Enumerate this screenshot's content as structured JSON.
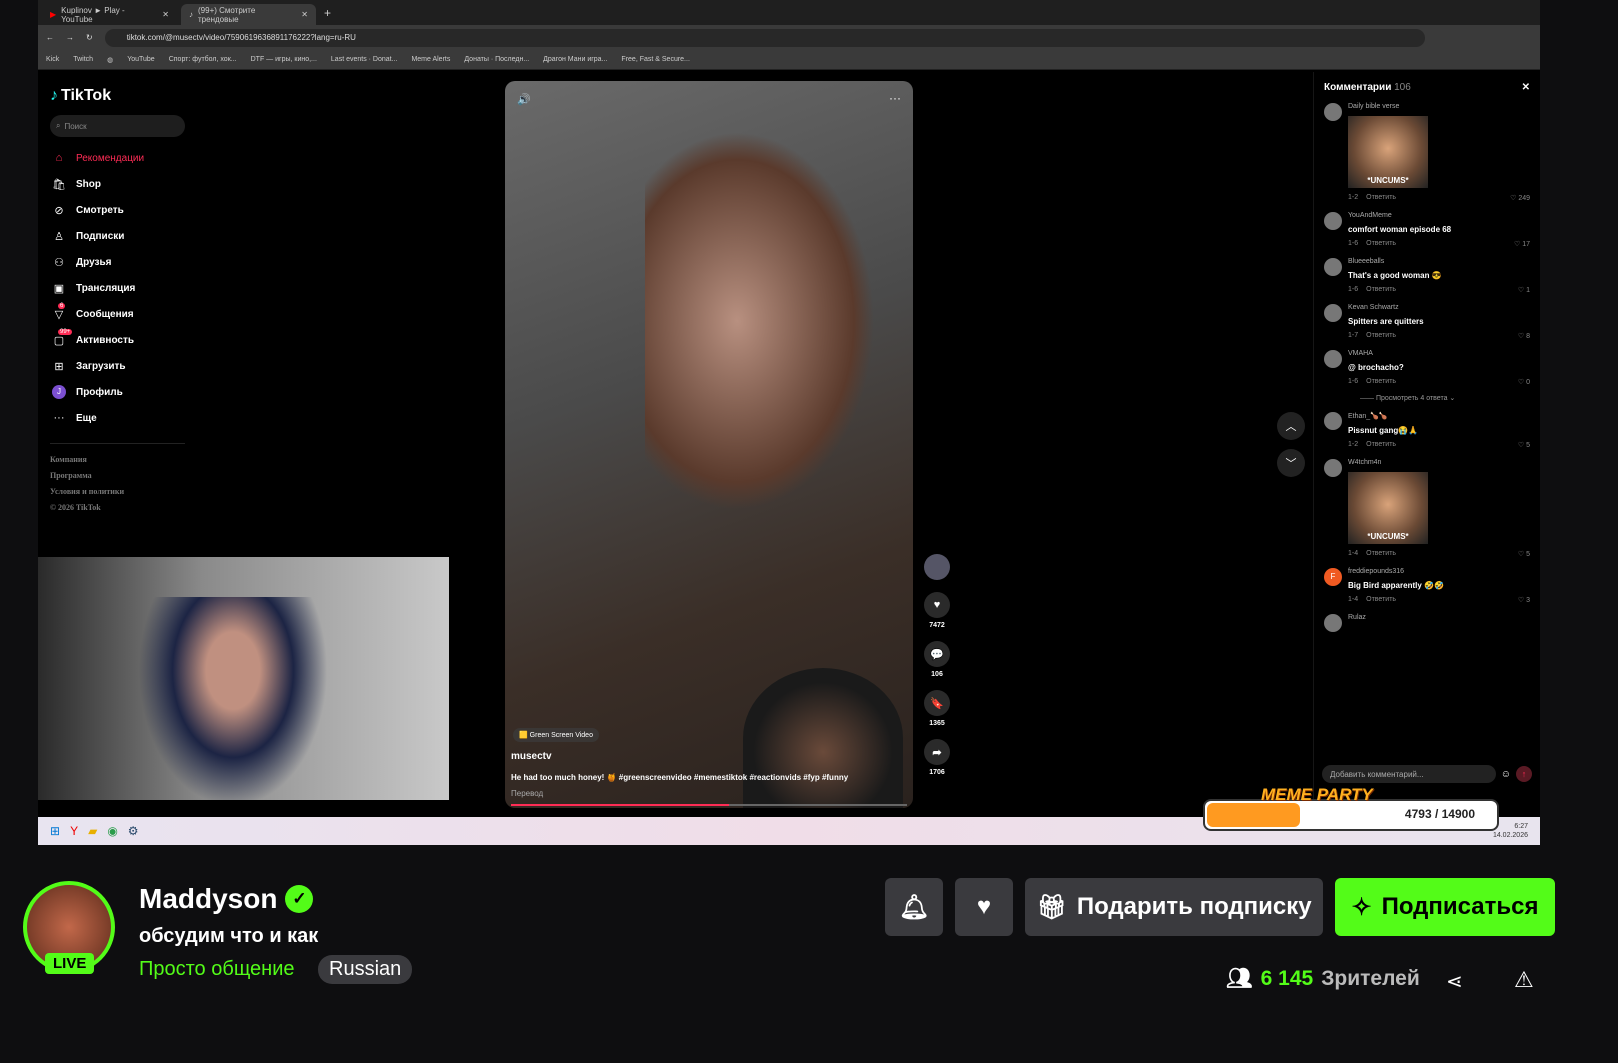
{
  "browser": {
    "tabs": [
      {
        "title": "Kuplinov ► Play - YouTube",
        "active": false
      },
      {
        "title": "(99+) Смотрите трендовые",
        "active": true
      }
    ],
    "url": "tiktok.com/@musectv/video/7590619636891176222?lang=ru-RU",
    "bookmarks": [
      "Kick",
      "Twitch",
      "",
      "YouTube",
      "Спорт: футбол, хок...",
      "DTF — игры, кино,...",
      "Last events · Donat...",
      "Meme Alerts",
      "Донаты · Последн...",
      "Драгон Мани игра...",
      "Free, Fast & Secure..."
    ]
  },
  "tiktok": {
    "logo": "TikTok",
    "search_placeholder": "Поиск",
    "nav": [
      {
        "label": "Рекомендации",
        "icon": "home-icon",
        "active": true
      },
      {
        "label": "Shop",
        "icon": "shop-icon"
      },
      {
        "label": "Смотреть",
        "icon": "compass-icon"
      },
      {
        "label": "Подписки",
        "icon": "following-icon"
      },
      {
        "label": "Друзья",
        "icon": "friends-icon"
      },
      {
        "label": "Трансляция",
        "icon": "live-icon"
      },
      {
        "label": "Сообщения",
        "icon": "messages-icon",
        "badge": "6"
      },
      {
        "label": "Активность",
        "icon": "activity-icon",
        "badge": "99+"
      },
      {
        "label": "Загрузить",
        "icon": "upload-icon"
      },
      {
        "label": "Профиль",
        "icon": "profile-avatar",
        "avatar": "J"
      },
      {
        "label": "Еще",
        "icon": "more-icon"
      }
    ],
    "footer": [
      "Компания",
      "Программа",
      "Условия и политики",
      "© 2026 TikTok"
    ],
    "video": {
      "badge": "Green Screen Video",
      "user": "musectv",
      "description": "He had too much honey! 🍯 #greenscreenvideo #memestiktok #reactionvids #fyp #funny",
      "translate": "Перевод",
      "progress": 0.55
    },
    "actions": {
      "likes": "7472",
      "comments": "106",
      "saves": "1365",
      "shares": "1706"
    },
    "comments": {
      "title": "Комментарии",
      "count": "106",
      "reply_label": "Ответить",
      "view_replies": "Просмотреть 4 ответа",
      "items": [
        {
          "user": "Daily bible verse",
          "image": "*UNCUMS*",
          "date": "1-2",
          "likes": "249"
        },
        {
          "user": "YouAndMeme",
          "text": "comfort woman episode 68",
          "date": "1-6",
          "likes": "17"
        },
        {
          "user": "Blueeeballs",
          "text": "That's a good woman 😎",
          "date": "1-6",
          "likes": "1"
        },
        {
          "user": "Kevan Schwartz",
          "text": "Spitters are quitters",
          "date": "1-7",
          "likes": "8"
        },
        {
          "user": "VMAHA",
          "text": "@ brochacho?",
          "date": "1-6",
          "likes": "0",
          "replies": true
        },
        {
          "user": "Ethan_🍗🍗",
          "text": "Pissnut gang😭🙏",
          "date": "1-2",
          "likes": "5"
        },
        {
          "user": "W4tchm4n",
          "image": "*UNCUMS*",
          "date": "1-4",
          "likes": "5"
        },
        {
          "user": "freddiepounds316",
          "text": "Big Bird apparently 🤣🤣",
          "date": "1-4",
          "likes": "3",
          "avatar": "F"
        },
        {
          "user": "Rulaz"
        }
      ],
      "input_placeholder": "Добавить комментарий..."
    }
  },
  "overlay": {
    "meme_party": "MEME PARTY",
    "progress_text": "4793 / 14900",
    "progress": 0.32
  },
  "taskbar": {
    "time": "6:27",
    "date": "14.02.2026"
  },
  "stream": {
    "streamer": "Maddyson",
    "live": "LIVE",
    "title": "обсудим что и как",
    "category": "Просто общение",
    "language": "Russian",
    "gift_label": "Подарить подписку",
    "subscribe_label": "Подписаться",
    "viewers": "6 145",
    "viewers_label": "Зрителей",
    "accent": "#53fc18"
  }
}
